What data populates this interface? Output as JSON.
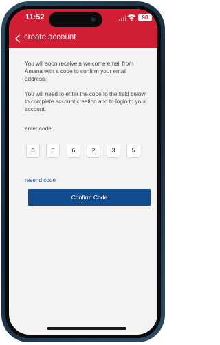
{
  "status_bar": {
    "time": "11:52",
    "battery": "90"
  },
  "nav": {
    "title": "create account"
  },
  "content": {
    "paragraph1": "You will soon receive a welcome email from Amana with a code to confirm your email address.",
    "paragraph2": "You will need to enter the code to the field below to complete account creation and to login to your account.",
    "code_label": "enter code:",
    "code_digits": [
      "8",
      "6",
      "6",
      "2",
      "3",
      "5"
    ],
    "resend_label": "resend code",
    "confirm_label": "Confirm Code"
  },
  "colors": {
    "header": "#d21e35",
    "button": "#104c8e",
    "link": "#1e4f96",
    "background": "#f3f3f3"
  },
  "icons": [
    "back-chevron-icon",
    "signal-icon",
    "wifi-icon",
    "battery-icon"
  ]
}
